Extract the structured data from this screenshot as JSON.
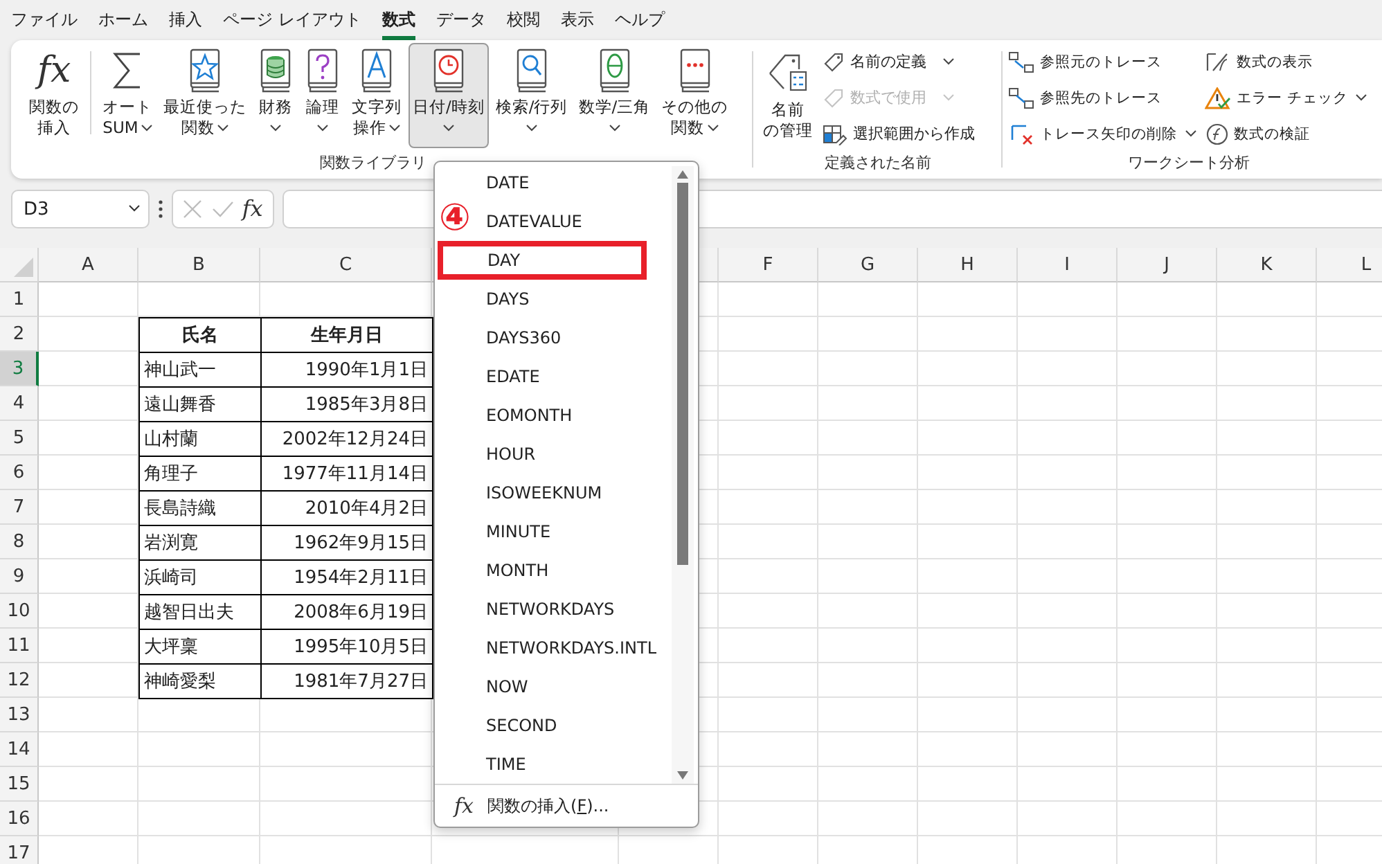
{
  "menu_tabs": [
    {
      "label": "ファイル",
      "selected": false
    },
    {
      "label": "ホーム",
      "selected": false
    },
    {
      "label": "挿入",
      "selected": false
    },
    {
      "label": "ページ レイアウト",
      "selected": false
    },
    {
      "label": "数式",
      "selected": true
    },
    {
      "label": "データ",
      "selected": false
    },
    {
      "label": "校閲",
      "selected": false
    },
    {
      "label": "表示",
      "selected": false
    },
    {
      "label": "ヘルプ",
      "selected": false
    }
  ],
  "ribbon": {
    "function_library": {
      "label": "関数ライブラリ",
      "insert_button": {
        "icon_text": "fx",
        "lines": [
          "関数の",
          "挿入"
        ]
      },
      "buttons": [
        {
          "lines": [
            "オート",
            "SUM"
          ],
          "dropdown": true,
          "pressed": false
        },
        {
          "lines": [
            "最近使った",
            "関数"
          ],
          "dropdown": true,
          "pressed": false
        },
        {
          "lines": [
            "財務"
          ],
          "dropdown": true,
          "pressed": false
        },
        {
          "lines": [
            "論理"
          ],
          "dropdown": true,
          "pressed": false
        },
        {
          "lines": [
            "文字列",
            "操作"
          ],
          "dropdown": true,
          "pressed": false
        },
        {
          "lines": [
            "日付/時刻"
          ],
          "dropdown": true,
          "pressed": true
        },
        {
          "lines": [
            "検索/行列"
          ],
          "dropdown": true,
          "pressed": false
        },
        {
          "lines": [
            "数学/三角"
          ],
          "dropdown": true,
          "pressed": false
        },
        {
          "lines": [
            "その他の",
            "関数"
          ],
          "dropdown": true,
          "pressed": false
        }
      ]
    },
    "defined_names": {
      "label": "定義された名前",
      "manager_button": {
        "lines": [
          "名前",
          "の管理"
        ]
      },
      "commands": [
        {
          "label": "名前の定義",
          "dropdown": true,
          "disabled": false
        },
        {
          "label": "数式で使用",
          "dropdown": true,
          "disabled": true
        },
        {
          "label": "選択範囲から作成",
          "dropdown": false,
          "disabled": false
        }
      ]
    },
    "formula_auditing": {
      "label": "ワークシート分析",
      "columns": [
        [
          {
            "label": "参照元のトレース",
            "dropdown": false
          },
          {
            "label": "参照先のトレース",
            "dropdown": false
          },
          {
            "label": "トレース矢印の削除",
            "dropdown": true
          }
        ],
        [
          {
            "label": "数式の表示",
            "dropdown": false
          },
          {
            "label": "エラー チェック",
            "dropdown": true
          },
          {
            "label": "数式の検証",
            "dropdown": false
          }
        ]
      ]
    }
  },
  "formula_bar": {
    "name_box": "D3",
    "fx_label": "fx"
  },
  "sheet": {
    "columns_left": [
      "A",
      "B",
      "C"
    ],
    "columns_right": [
      "F",
      "G",
      "H",
      "I",
      "J",
      "K",
      "L"
    ],
    "row_numbers": [
      {
        "label": "1",
        "selected": false
      },
      {
        "label": "2",
        "selected": false
      },
      {
        "label": "3",
        "selected": true
      },
      {
        "label": "4",
        "selected": false
      },
      {
        "label": "5",
        "selected": false
      },
      {
        "label": "6",
        "selected": false
      },
      {
        "label": "7",
        "selected": false
      },
      {
        "label": "8",
        "selected": false
      },
      {
        "label": "9",
        "selected": false
      },
      {
        "label": "10",
        "selected": false
      },
      {
        "label": "11",
        "selected": false
      },
      {
        "label": "12",
        "selected": false
      },
      {
        "label": "13",
        "selected": false
      },
      {
        "label": "14",
        "selected": false
      },
      {
        "label": "15",
        "selected": false
      },
      {
        "label": "16",
        "selected": false
      },
      {
        "label": "17",
        "selected": false
      }
    ],
    "table": {
      "header": [
        "氏名",
        "生年月日"
      ],
      "rows": [
        [
          "神山武一",
          "1990年1月1日"
        ],
        [
          "遠山舞香",
          "1985年3月8日"
        ],
        [
          "山村蘭",
          "2002年12月24日"
        ],
        [
          "角理子",
          "1977年11月14日"
        ],
        [
          "長島詩織",
          "2010年4月2日"
        ],
        [
          "岩渕寛",
          "1962年9月15日"
        ],
        [
          "浜崎司",
          "1954年2月11日"
        ],
        [
          "越智日出夫",
          "2008年6月19日"
        ],
        [
          "大坪稟",
          "1995年10月5日"
        ],
        [
          "神崎愛梨",
          "1981年7月27日"
        ]
      ]
    }
  },
  "dropdown": {
    "annotation": "④",
    "items": [
      {
        "label": "DATE",
        "marked": false
      },
      {
        "label": "DATEVALUE",
        "marked": false
      },
      {
        "label": "DAY",
        "marked": true
      },
      {
        "label": "DAYS",
        "marked": false
      },
      {
        "label": "DAYS360",
        "marked": false
      },
      {
        "label": "EDATE",
        "marked": false
      },
      {
        "label": "EOMONTH",
        "marked": false
      },
      {
        "label": "HOUR",
        "marked": false
      },
      {
        "label": "ISOWEEKNUM",
        "marked": false
      },
      {
        "label": "MINUTE",
        "marked": false
      },
      {
        "label": "MONTH",
        "marked": false
      },
      {
        "label": "NETWORKDAYS",
        "marked": false
      },
      {
        "label": "NETWORKDAYS.INTL",
        "marked": false
      },
      {
        "label": "NOW",
        "marked": false
      },
      {
        "label": "SECOND",
        "marked": false
      },
      {
        "label": "TIME",
        "marked": false
      }
    ],
    "footer": {
      "icon_text": "fx",
      "before": "関数の挿入(",
      "key": "F",
      "after": ")..."
    }
  }
}
